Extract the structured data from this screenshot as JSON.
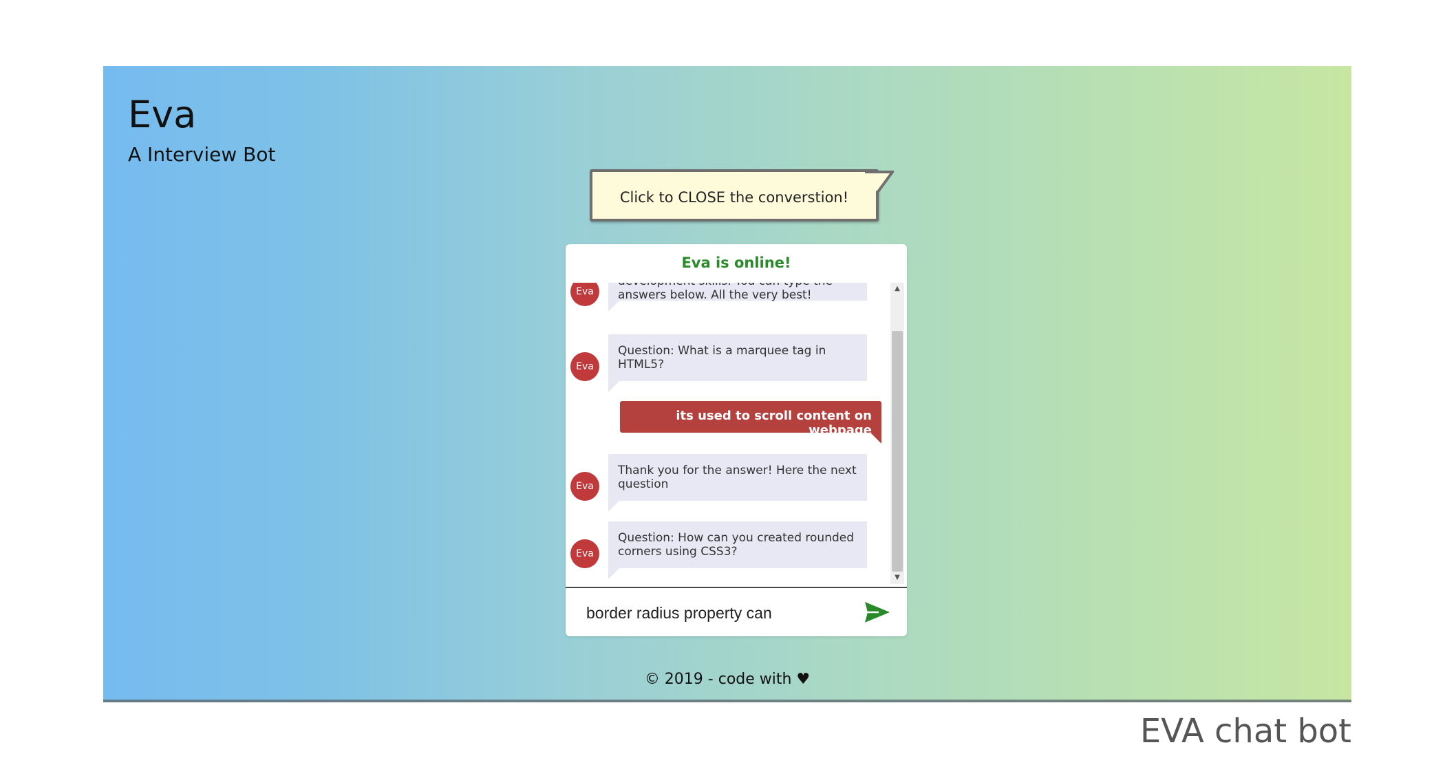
{
  "header": {
    "title": "Eva",
    "subtitle": "A Interview Bot"
  },
  "callout": {
    "text": "Click to CLOSE the converstion!"
  },
  "chat": {
    "status": "Eva is online!",
    "avatar_label": "Eva",
    "messages": [
      {
        "from": "bot",
        "text": "development skills. You can type the answers below. All the very best!"
      },
      {
        "from": "bot",
        "text": "Question: What is a marquee tag in HTML5?"
      },
      {
        "from": "user",
        "text": "its used to scroll content on webpage"
      },
      {
        "from": "bot",
        "text": "Thank you for the answer! Here the next question"
      },
      {
        "from": "bot",
        "text": "Question: How can you created rounded corners using CSS3?"
      }
    ],
    "input_value": "border radius property can",
    "send_icon": "send-icon",
    "colors": {
      "status": "#2a8a2a",
      "user_bubble": "#b5413f",
      "bot_bubble": "#e7e8f3",
      "avatar": "#c0393b"
    }
  },
  "footer": {
    "text": "© 2019 - code with ♥"
  },
  "caption": "EVA chat bot"
}
